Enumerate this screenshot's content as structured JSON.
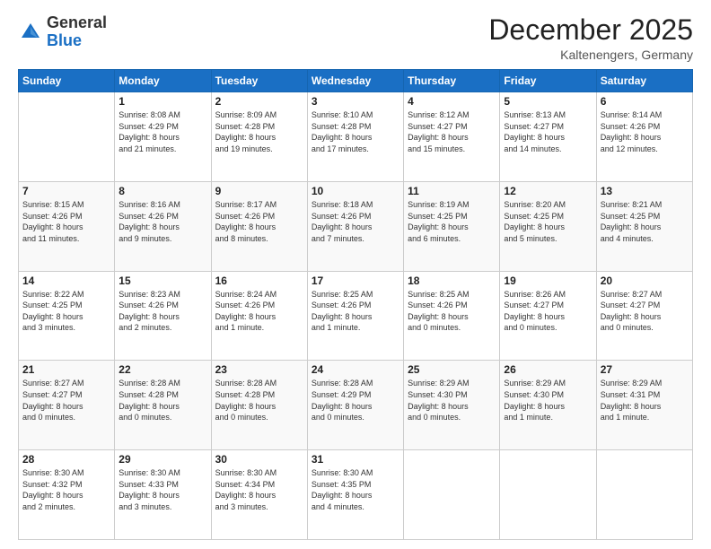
{
  "logo": {
    "general": "General",
    "blue": "Blue"
  },
  "header": {
    "month": "December 2025",
    "location": "Kaltenengers, Germany"
  },
  "days_header": [
    "Sunday",
    "Monday",
    "Tuesday",
    "Wednesday",
    "Thursday",
    "Friday",
    "Saturday"
  ],
  "weeks": [
    [
      {
        "day": "",
        "info": ""
      },
      {
        "day": "1",
        "info": "Sunrise: 8:08 AM\nSunset: 4:29 PM\nDaylight: 8 hours\nand 21 minutes."
      },
      {
        "day": "2",
        "info": "Sunrise: 8:09 AM\nSunset: 4:28 PM\nDaylight: 8 hours\nand 19 minutes."
      },
      {
        "day": "3",
        "info": "Sunrise: 8:10 AM\nSunset: 4:28 PM\nDaylight: 8 hours\nand 17 minutes."
      },
      {
        "day": "4",
        "info": "Sunrise: 8:12 AM\nSunset: 4:27 PM\nDaylight: 8 hours\nand 15 minutes."
      },
      {
        "day": "5",
        "info": "Sunrise: 8:13 AM\nSunset: 4:27 PM\nDaylight: 8 hours\nand 14 minutes."
      },
      {
        "day": "6",
        "info": "Sunrise: 8:14 AM\nSunset: 4:26 PM\nDaylight: 8 hours\nand 12 minutes."
      }
    ],
    [
      {
        "day": "7",
        "info": "Sunrise: 8:15 AM\nSunset: 4:26 PM\nDaylight: 8 hours\nand 11 minutes."
      },
      {
        "day": "8",
        "info": "Sunrise: 8:16 AM\nSunset: 4:26 PM\nDaylight: 8 hours\nand 9 minutes."
      },
      {
        "day": "9",
        "info": "Sunrise: 8:17 AM\nSunset: 4:26 PM\nDaylight: 8 hours\nand 8 minutes."
      },
      {
        "day": "10",
        "info": "Sunrise: 8:18 AM\nSunset: 4:26 PM\nDaylight: 8 hours\nand 7 minutes."
      },
      {
        "day": "11",
        "info": "Sunrise: 8:19 AM\nSunset: 4:25 PM\nDaylight: 8 hours\nand 6 minutes."
      },
      {
        "day": "12",
        "info": "Sunrise: 8:20 AM\nSunset: 4:25 PM\nDaylight: 8 hours\nand 5 minutes."
      },
      {
        "day": "13",
        "info": "Sunrise: 8:21 AM\nSunset: 4:25 PM\nDaylight: 8 hours\nand 4 minutes."
      }
    ],
    [
      {
        "day": "14",
        "info": "Sunrise: 8:22 AM\nSunset: 4:25 PM\nDaylight: 8 hours\nand 3 minutes."
      },
      {
        "day": "15",
        "info": "Sunrise: 8:23 AM\nSunset: 4:26 PM\nDaylight: 8 hours\nand 2 minutes."
      },
      {
        "day": "16",
        "info": "Sunrise: 8:24 AM\nSunset: 4:26 PM\nDaylight: 8 hours\nand 1 minute."
      },
      {
        "day": "17",
        "info": "Sunrise: 8:25 AM\nSunset: 4:26 PM\nDaylight: 8 hours\nand 1 minute."
      },
      {
        "day": "18",
        "info": "Sunrise: 8:25 AM\nSunset: 4:26 PM\nDaylight: 8 hours\nand 0 minutes."
      },
      {
        "day": "19",
        "info": "Sunrise: 8:26 AM\nSunset: 4:27 PM\nDaylight: 8 hours\nand 0 minutes."
      },
      {
        "day": "20",
        "info": "Sunrise: 8:27 AM\nSunset: 4:27 PM\nDaylight: 8 hours\nand 0 minutes."
      }
    ],
    [
      {
        "day": "21",
        "info": "Sunrise: 8:27 AM\nSunset: 4:27 PM\nDaylight: 8 hours\nand 0 minutes."
      },
      {
        "day": "22",
        "info": "Sunrise: 8:28 AM\nSunset: 4:28 PM\nDaylight: 8 hours\nand 0 minutes."
      },
      {
        "day": "23",
        "info": "Sunrise: 8:28 AM\nSunset: 4:28 PM\nDaylight: 8 hours\nand 0 minutes."
      },
      {
        "day": "24",
        "info": "Sunrise: 8:28 AM\nSunset: 4:29 PM\nDaylight: 8 hours\nand 0 minutes."
      },
      {
        "day": "25",
        "info": "Sunrise: 8:29 AM\nSunset: 4:30 PM\nDaylight: 8 hours\nand 0 minutes."
      },
      {
        "day": "26",
        "info": "Sunrise: 8:29 AM\nSunset: 4:30 PM\nDaylight: 8 hours\nand 1 minute."
      },
      {
        "day": "27",
        "info": "Sunrise: 8:29 AM\nSunset: 4:31 PM\nDaylight: 8 hours\nand 1 minute."
      }
    ],
    [
      {
        "day": "28",
        "info": "Sunrise: 8:30 AM\nSunset: 4:32 PM\nDaylight: 8 hours\nand 2 minutes."
      },
      {
        "day": "29",
        "info": "Sunrise: 8:30 AM\nSunset: 4:33 PM\nDaylight: 8 hours\nand 3 minutes."
      },
      {
        "day": "30",
        "info": "Sunrise: 8:30 AM\nSunset: 4:34 PM\nDaylight: 8 hours\nand 3 minutes."
      },
      {
        "day": "31",
        "info": "Sunrise: 8:30 AM\nSunset: 4:35 PM\nDaylight: 8 hours\nand 4 minutes."
      },
      {
        "day": "",
        "info": ""
      },
      {
        "day": "",
        "info": ""
      },
      {
        "day": "",
        "info": ""
      }
    ]
  ]
}
